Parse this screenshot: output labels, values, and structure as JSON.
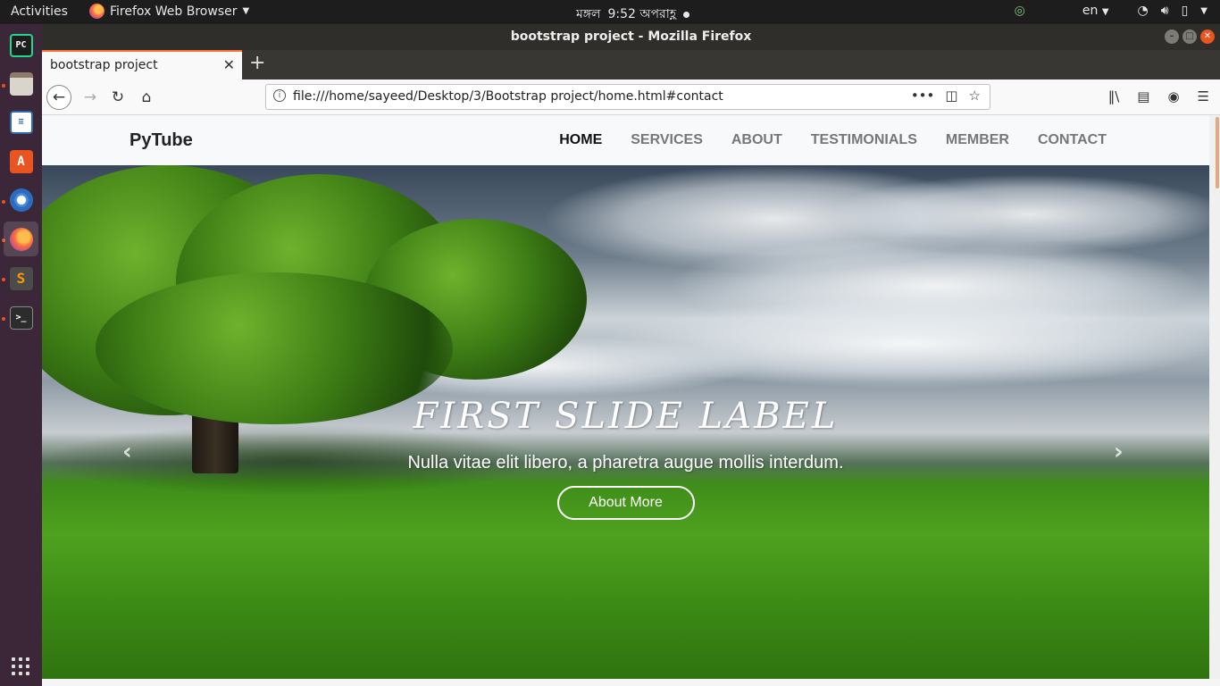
{
  "system_bar": {
    "activities": "Activities",
    "app_name": "Firefox Web Browser",
    "clock_day": "মঙ্গল",
    "clock_time": "9:52 অপরাহ্ণ",
    "language": "en"
  },
  "window": {
    "title": "bootstrap project - Mozilla Firefox"
  },
  "browser": {
    "tab_title": "bootstrap project",
    "url": "file:///home/sayeed/Desktop/3/Bootstrap project/home.html#contact"
  },
  "site": {
    "brand": "PyTube",
    "menu": [
      "HOME",
      "SERVICES",
      "ABOUT",
      "TESTIMONIALS",
      "MEMBER",
      "CONTACT"
    ],
    "active_menu": "HOME",
    "slide": {
      "title": "FIRST SLIDE LABEL",
      "text": "Nulla vitae elit libero, a pharetra augue mollis interdum.",
      "button": "About More"
    }
  },
  "colors": {
    "dock_bg": "#3b2737",
    "accent": "#e95420",
    "tab_highlight": "#ff7139"
  }
}
